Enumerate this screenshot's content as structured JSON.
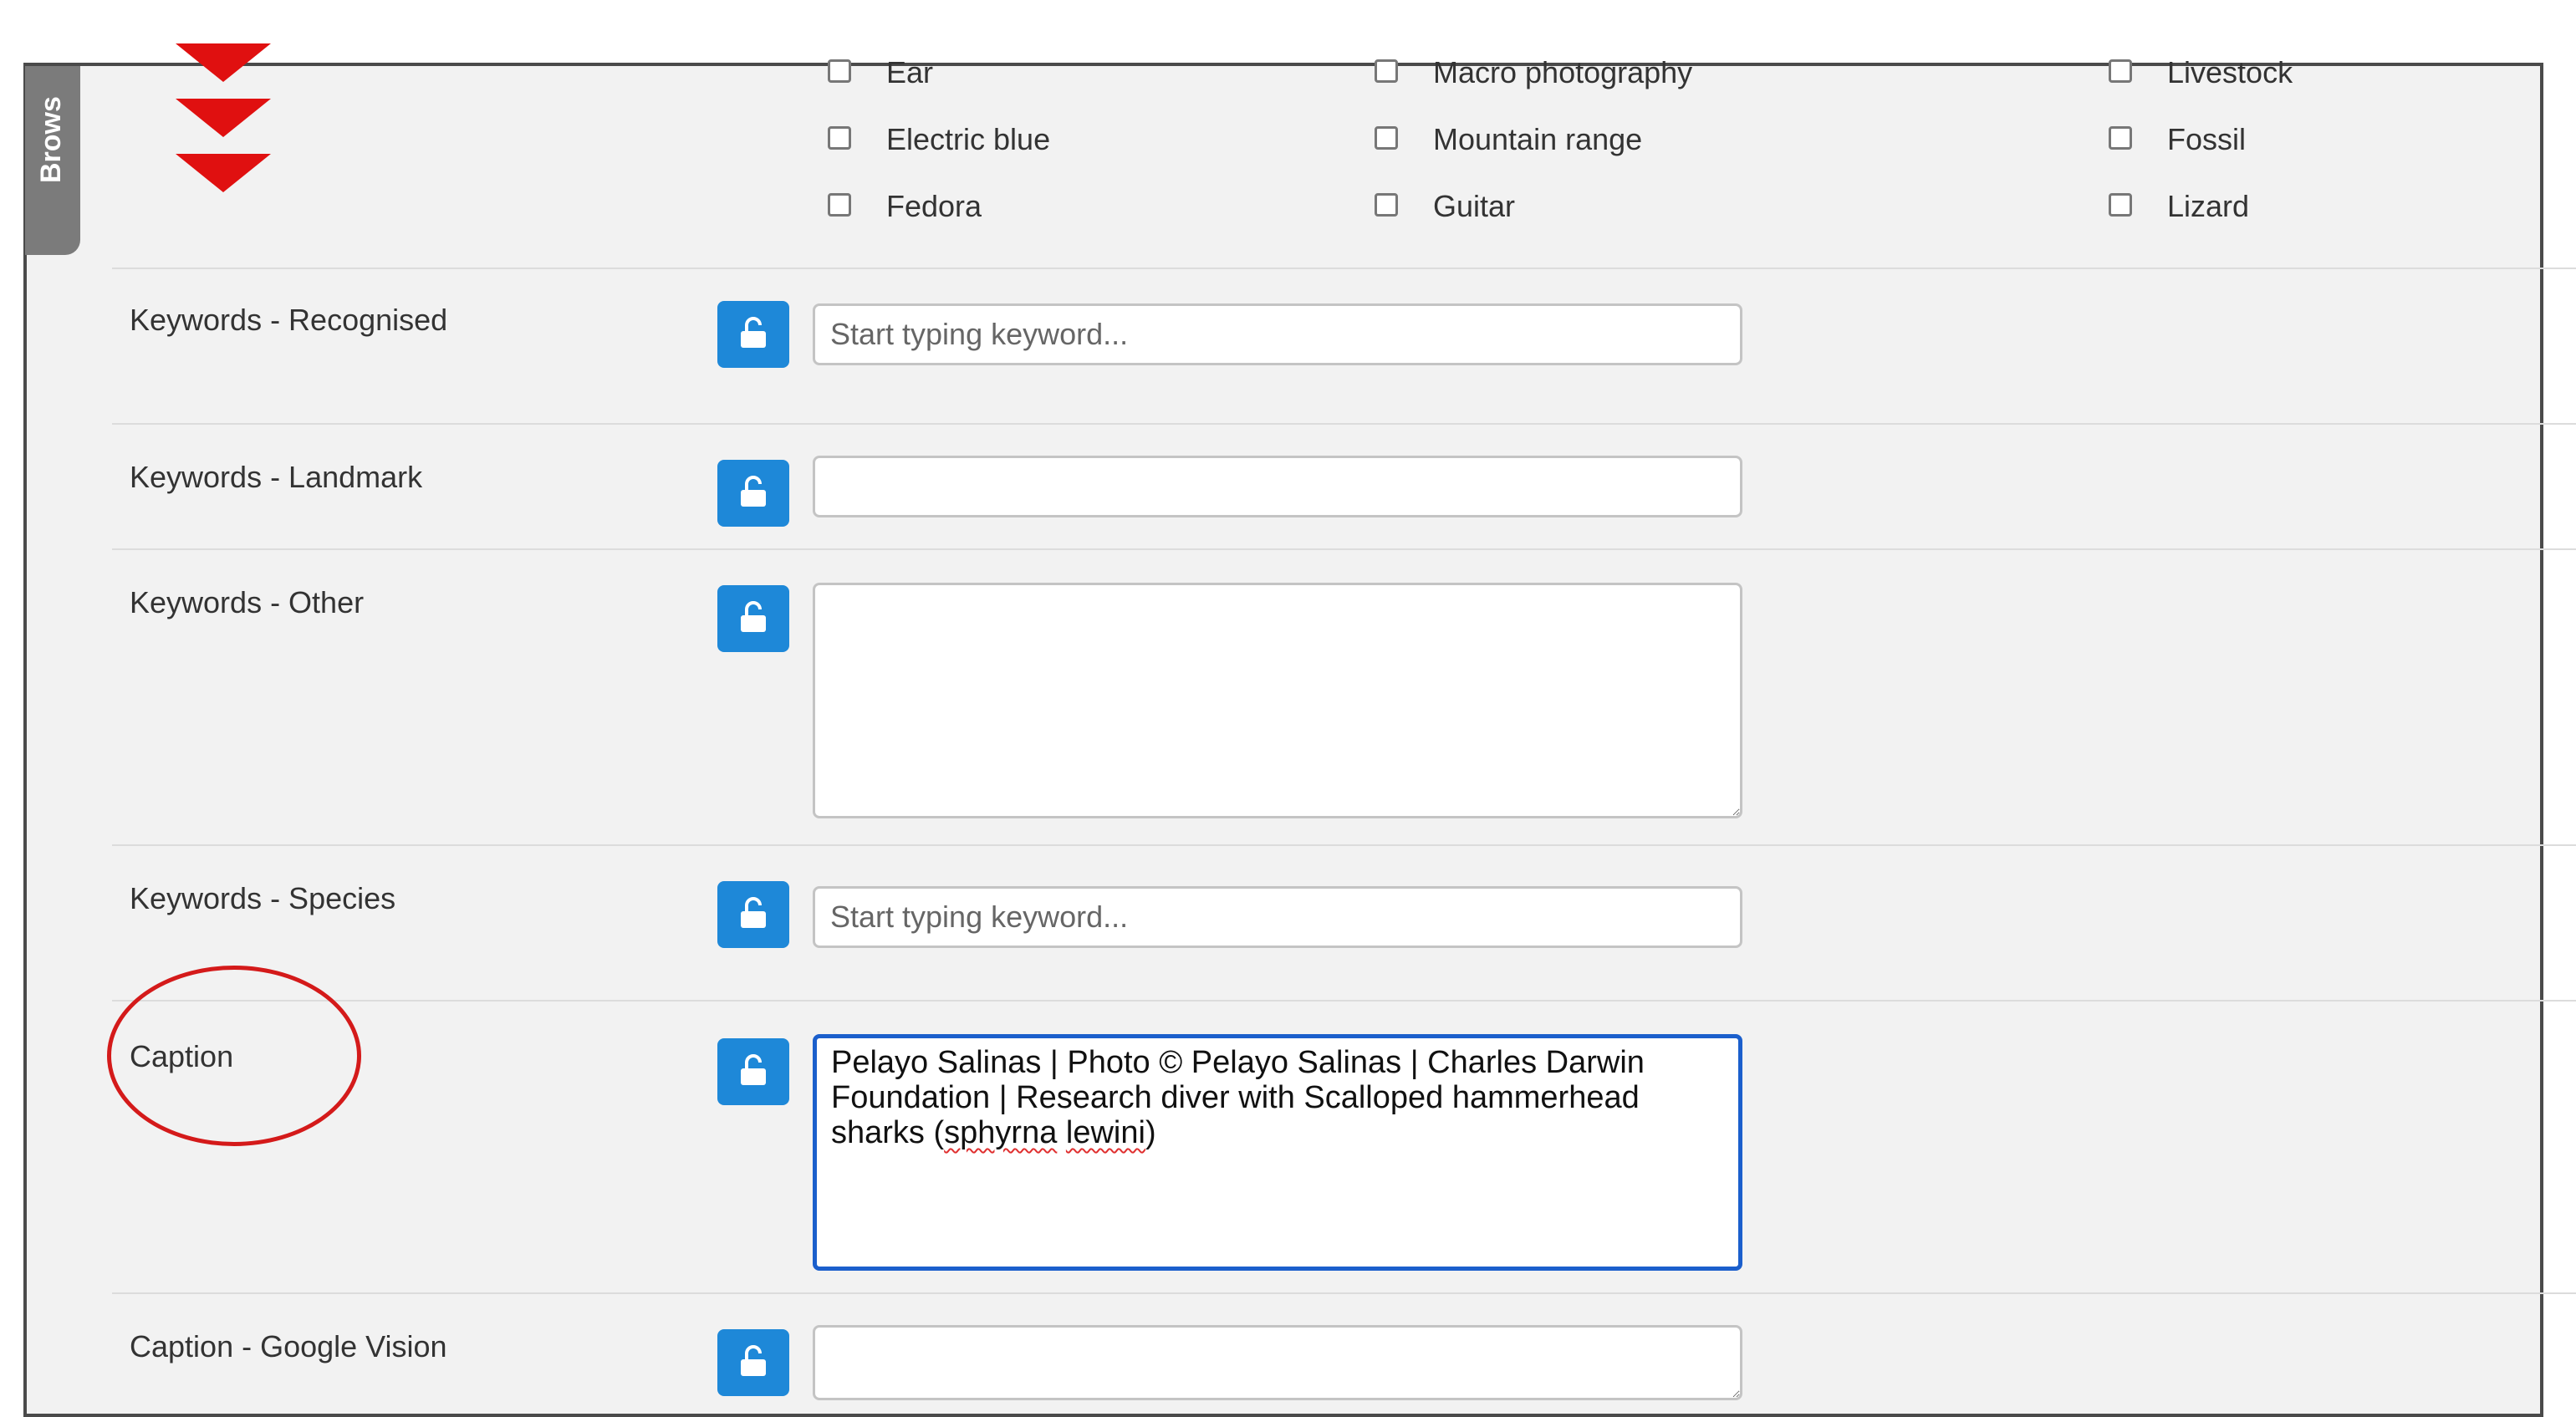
{
  "sidebar_tab": {
    "label": "Brows"
  },
  "keyword_options": {
    "col1": [
      {
        "label": "Ear",
        "checked": false
      },
      {
        "label": "Electric blue",
        "checked": false
      },
      {
        "label": "Fedora",
        "checked": false
      }
    ],
    "col2": [
      {
        "label": "Macro photography",
        "checked": false
      },
      {
        "label": "Mountain range",
        "checked": false
      },
      {
        "label": "Guitar",
        "checked": false
      }
    ],
    "col3": [
      {
        "label": "Livestock",
        "checked": false
      },
      {
        "label": "Fossil",
        "checked": false
      },
      {
        "label": "Lizard",
        "checked": false
      }
    ]
  },
  "fields": {
    "keywords_recognised": {
      "label": "Keywords - Recognised",
      "placeholder": "Start typing keyword...",
      "value": ""
    },
    "keywords_landmark": {
      "label": "Keywords - Landmark",
      "value": ""
    },
    "keywords_other": {
      "label": "Keywords - Other",
      "value": ""
    },
    "keywords_species": {
      "label": "Keywords - Species",
      "placeholder": "Start typing keyword...",
      "value": ""
    },
    "caption": {
      "label": "Caption",
      "value": "Pelayo Salinas | Photo © Pelayo Salinas | Charles Darwin Foundation | Research diver with Scalloped hammerhead sharks (sphyrna lewini)",
      "text_before": "Pelayo Salinas | Photo © Pelayo Salinas | Charles Darwin Foundation | Research diver with Scalloped hammerhead sharks (",
      "misspelled_1": "sphyrna",
      "text_middle": " ",
      "misspelled_2": "lewini",
      "text_after": ")"
    },
    "caption_google_vision": {
      "label": "Caption - Google Vision",
      "value": ""
    }
  },
  "icons": {
    "lock": "unlock-padlock-icon",
    "annotation_arrows": "triple-down-chevron-annotation",
    "annotation_circle": "red-circle-annotation"
  },
  "colors": {
    "lock_button": "#1e88d8",
    "annotation_red": "#e01010",
    "focus_border": "#1b5fcc",
    "panel_background": "#f2f2f2"
  }
}
